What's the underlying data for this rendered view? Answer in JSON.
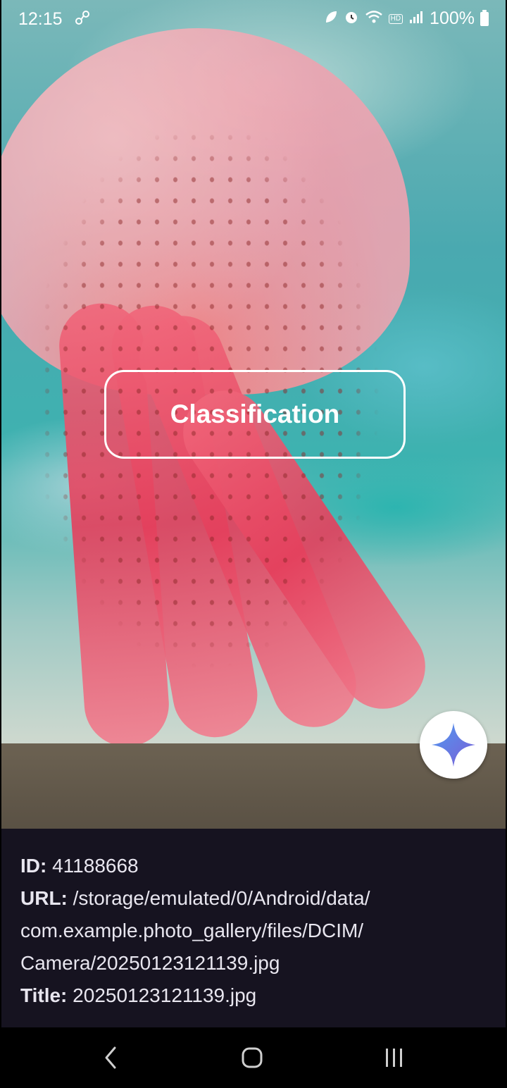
{
  "status_bar": {
    "time": "12:15",
    "left_icon": "link-icon",
    "icons": [
      "leaf-icon",
      "alarm-icon",
      "wifi-icon",
      "hd-voice-icon",
      "signal-icon"
    ],
    "hd_label": "HD",
    "battery": "100%"
  },
  "main": {
    "classify_button_label": "Classification",
    "fab_icon": "sparkle-icon"
  },
  "info": {
    "id_label": "ID:",
    "id_value": "41188668",
    "url_label": "URL:",
    "url_line1": "/storage/emulated/0/Android/data/",
    "url_line2": "com.example.photo_gallery/files/DCIM/",
    "url_line3": "Camera/20250123121139.jpg",
    "title_label": "Title:",
    "title_value": "20250123121139.jpg"
  },
  "nav": {
    "back_icon": "back-icon",
    "home_icon": "home-icon",
    "recents_icon": "recents-icon"
  },
  "colors": {
    "info_background": "#161320",
    "fab_gradient_start": "#4f7df0",
    "fab_gradient_end": "#7b5cd6"
  }
}
